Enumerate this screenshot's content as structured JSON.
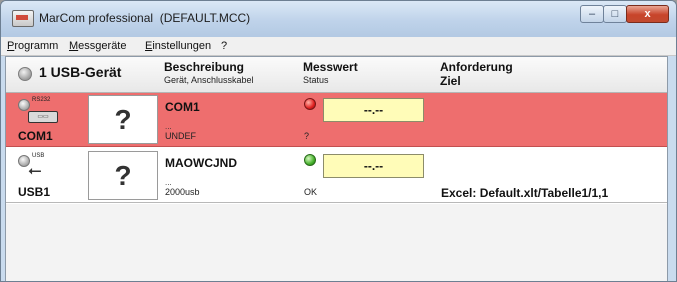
{
  "window": {
    "title": "MarCom professional  (DEFAULT.MCC)",
    "buttons": {
      "minimize": "–",
      "maximize": "□",
      "close": "x"
    }
  },
  "menu": [
    {
      "pre": "",
      "u": "P",
      "post": "rogramm"
    },
    {
      "pre": "",
      "u": "M",
      "post": "essgeräte"
    },
    {
      "pre": "",
      "u": "E",
      "post": "instellungen"
    },
    {
      "pre": "",
      "u": "",
      "post": "?"
    }
  ],
  "header": {
    "device_count": "1 USB-Gerät",
    "beschreibung": "Beschreibung",
    "beschreibung_sub": "Gerät, Anschlusskabel",
    "messwert": "Messwert",
    "messwert_sub": "Status",
    "anforderung": "Anforderung",
    "ziel": "Ziel"
  },
  "devices": [
    {
      "port_label": "RS232",
      "icon": "rs232-connector-icon",
      "name": "COM1",
      "placeholder": "?",
      "description": "COM1",
      "dots": "...",
      "sub": "UNDEF",
      "value": "--.--",
      "status": "?",
      "ziel": "",
      "led": "red",
      "row_color": "#ee6e6e"
    },
    {
      "port_label": "USB",
      "icon": "usb-icon",
      "name": "USB1",
      "placeholder": "?",
      "description": "MAOWCJND",
      "dots": "...",
      "sub": "2000usb",
      "value": "--.--",
      "status": "OK",
      "ziel": "Excel: Default.xlt/Tabelle1/1,1",
      "led": "green",
      "row_color": "#ffffff"
    }
  ]
}
